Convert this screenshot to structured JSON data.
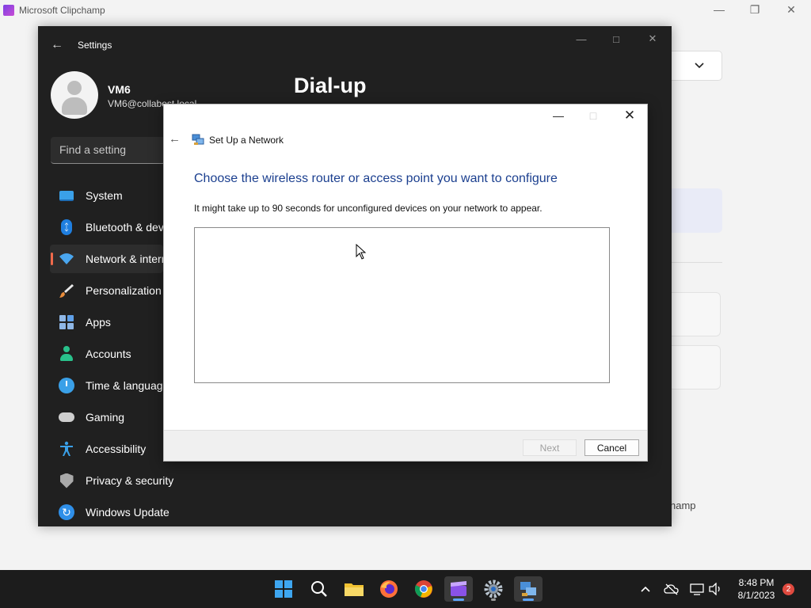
{
  "clipchamp": {
    "window_title": "Microsoft Clipchamp",
    "partial_text": "hamp"
  },
  "settings": {
    "window_title": "Settings",
    "user_name": "VM6",
    "user_email": "VM6@collabest.local",
    "search_placeholder": "Find a setting",
    "page_title": "Dial-up",
    "nav": [
      {
        "label": "System",
        "icon": "system-icon"
      },
      {
        "label": "Bluetooth & devices",
        "icon": "bluetooth-icon"
      },
      {
        "label": "Network & internet",
        "icon": "wifi-icon",
        "active": true
      },
      {
        "label": "Personalization",
        "icon": "brush-icon"
      },
      {
        "label": "Apps",
        "icon": "apps-icon"
      },
      {
        "label": "Accounts",
        "icon": "person-icon"
      },
      {
        "label": "Time & language",
        "icon": "clock-globe-icon"
      },
      {
        "label": "Gaming",
        "icon": "gamepad-icon"
      },
      {
        "label": "Accessibility",
        "icon": "accessibility-icon"
      },
      {
        "label": "Privacy & security",
        "icon": "shield-icon"
      },
      {
        "label": "Windows Update",
        "icon": "update-icon"
      }
    ]
  },
  "dialog": {
    "title": "Set Up a Network",
    "heading": "Choose the wireless router or access point you want to configure",
    "description": "It might take up to 90 seconds for unconfigured devices on your network to appear.",
    "next_label": "Next",
    "cancel_label": "Cancel"
  },
  "taskbar": {
    "time": "8:48 PM",
    "date": "8/1/2023",
    "notification_count": "2"
  }
}
